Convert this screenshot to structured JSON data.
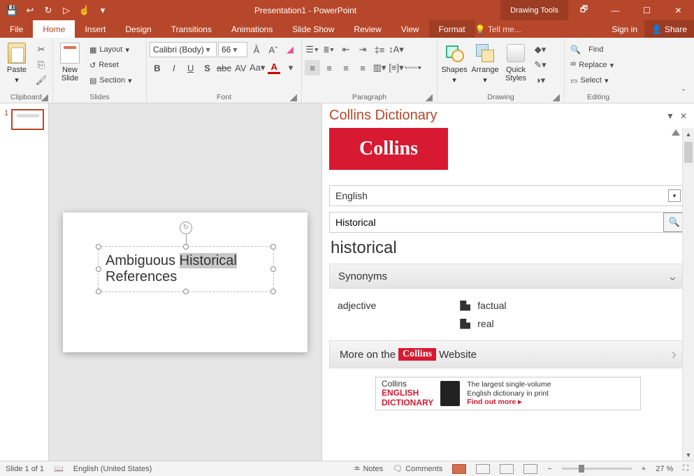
{
  "titlebar": {
    "title": "Presentation1 - PowerPoint",
    "contextual_group": "Drawing Tools"
  },
  "qat": {
    "save": "💾",
    "undo": "↩",
    "redo": "↻",
    "start": "▷",
    "touch": "☝"
  },
  "window": {
    "restore_btn": "🗗",
    "min": "—",
    "max": "☐",
    "close": "✕"
  },
  "menubar": {
    "file": "File",
    "home": "Home",
    "insert": "Insert",
    "design": "Design",
    "transitions": "Transitions",
    "animations": "Animations",
    "slideshow": "Slide Show",
    "review": "Review",
    "view": "View",
    "format": "Format",
    "tellme": "Tell me...",
    "signin": "Sign in",
    "share": "Share"
  },
  "ribbon": {
    "clipboard": {
      "label": "Clipboard",
      "paste": "Paste"
    },
    "slides": {
      "label": "Slides",
      "new_slide": "New\nSlide",
      "layout": "Layout",
      "reset": "Reset",
      "section": "Section"
    },
    "font": {
      "label": "Font",
      "family": "Calibri (Body)",
      "size": "66"
    },
    "paragraph": {
      "label": "Paragraph"
    },
    "drawing": {
      "label": "Drawing",
      "shapes": "Shapes",
      "arrange": "Arrange",
      "quick_styles": "Quick\nStyles"
    },
    "editing": {
      "label": "Editing",
      "find": "Find",
      "replace": "Replace",
      "select": "Select"
    }
  },
  "thumbnails": {
    "num1": "1"
  },
  "slide": {
    "line1_a": "Ambiguous ",
    "line1_b": "Historical",
    "line2": "References"
  },
  "taskpane": {
    "title": "Collins Dictionary",
    "logo": "Collins",
    "language": "English",
    "search_value": "Historical",
    "word": "historical",
    "synonyms_header": "Synonyms",
    "pos": "adjective",
    "syn1": "factual",
    "syn2": "real",
    "more_pre": "More on the ",
    "more_logo": "Collins",
    "more_post": " Website",
    "ad_title1": "Collins",
    "ad_title2": "ENGLISH",
    "ad_title3": "DICTIONARY",
    "ad_blurb1": "The largest single-volume",
    "ad_blurb2": "English dictionary in print",
    "ad_cta": "Find out more ▸"
  },
  "statusbar": {
    "slide": "Slide 1 of 1",
    "lang": "English (United States)",
    "notes": "Notes",
    "comments": "Comments",
    "zoom": "27 %",
    "minus": "−",
    "plus": "+"
  }
}
